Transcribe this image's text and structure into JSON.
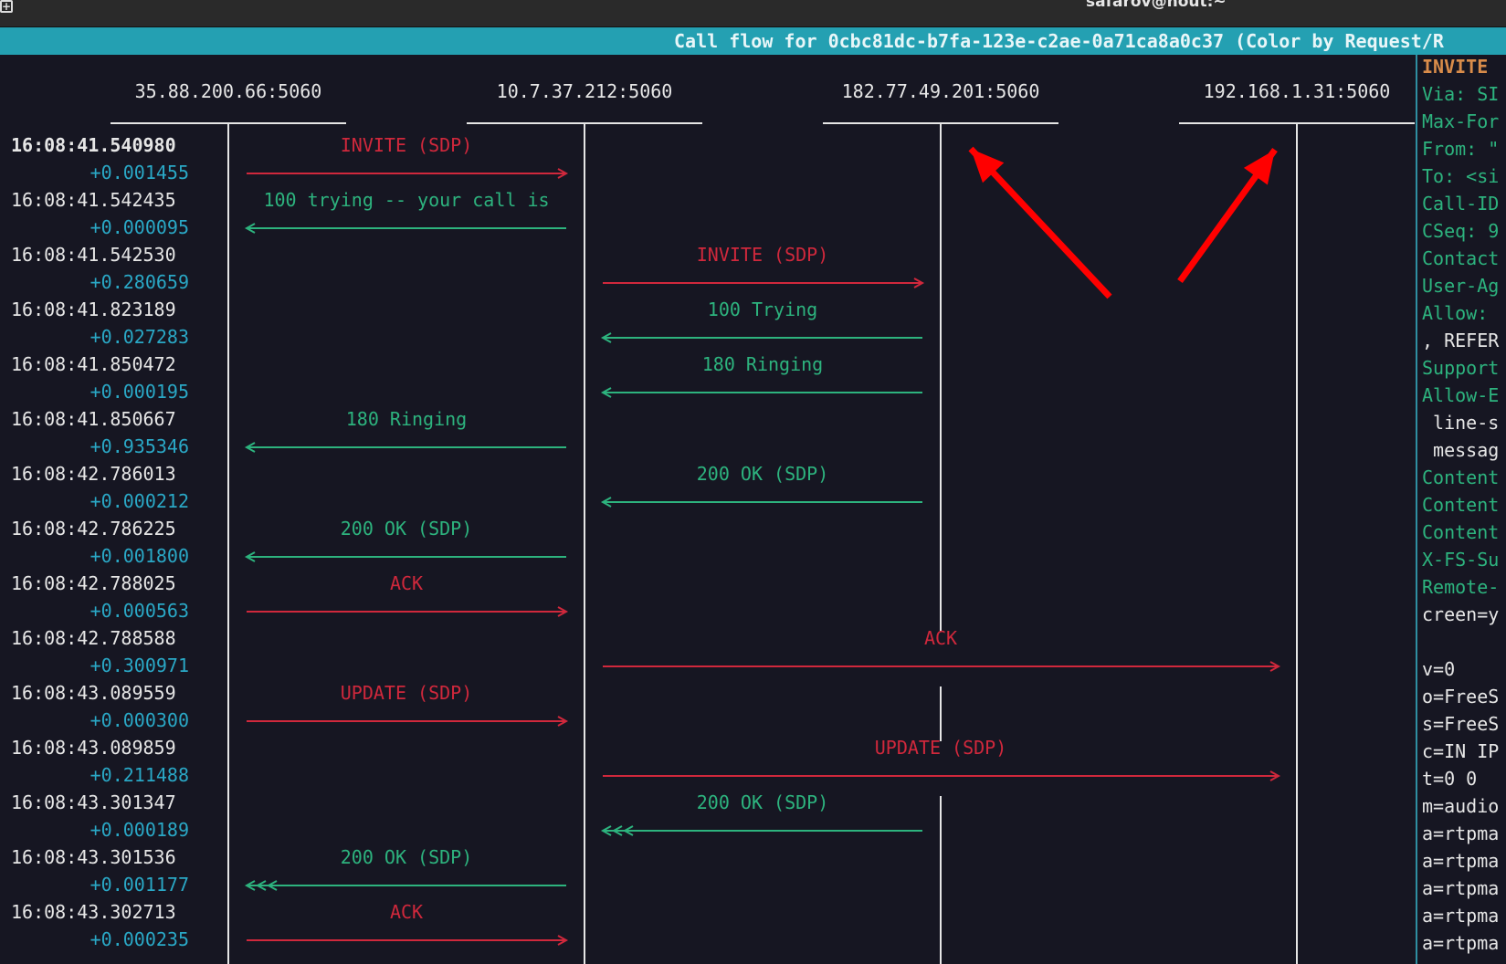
{
  "window": {
    "title": "safarov@nout:~",
    "newtab_glyph": "+"
  },
  "header": {
    "text": "Call flow for 0cbc81dc-b7fa-123e-c2ae-0a71ca8a0c37 (Color by Request/R"
  },
  "colors": {
    "request": "#d0283c",
    "response": "#2db37e",
    "delta": "#2aa8c6",
    "time": "#e6e6e6",
    "lifeline": "#e6e6e6",
    "annotation_arrows": "#ff0000"
  },
  "hosts": [
    "35.88.200.66:5060",
    "10.7.37.212:5060",
    "182.77.49.201:5060",
    "192.168.1.31:5060"
  ],
  "rows": [
    {
      "time": "16:08:41.540980",
      "delta": "+0.001455",
      "label": "INVITE (SDP)",
      "kind": "request",
      "from": 0,
      "to": 1,
      "selected": true
    },
    {
      "time": "16:08:41.542435",
      "delta": "+0.000095",
      "label": "100 trying -- your call is",
      "kind": "response",
      "from": 1,
      "to": 0
    },
    {
      "time": "16:08:41.542530",
      "delta": "+0.280659",
      "label": "INVITE (SDP)",
      "kind": "request",
      "from": 1,
      "to": 2
    },
    {
      "time": "16:08:41.823189",
      "delta": "+0.027283",
      "label": "100 Trying",
      "kind": "response",
      "from": 2,
      "to": 1
    },
    {
      "time": "16:08:41.850472",
      "delta": "+0.000195",
      "label": "180 Ringing",
      "kind": "response",
      "from": 2,
      "to": 1
    },
    {
      "time": "16:08:41.850667",
      "delta": "+0.935346",
      "label": "180 Ringing",
      "kind": "response",
      "from": 1,
      "to": 0
    },
    {
      "time": "16:08:42.786013",
      "delta": "+0.000212",
      "label": "200 OK (SDP)",
      "kind": "response",
      "from": 2,
      "to": 1
    },
    {
      "time": "16:08:42.786225",
      "delta": "+0.001800",
      "label": "200 OK (SDP)",
      "kind": "response",
      "from": 1,
      "to": 0
    },
    {
      "time": "16:08:42.788025",
      "delta": "+0.000563",
      "label": "ACK",
      "kind": "request",
      "from": 0,
      "to": 1
    },
    {
      "time": "16:08:42.788588",
      "delta": "+0.300971",
      "label": "ACK",
      "kind": "request",
      "from": 1,
      "to": 3
    },
    {
      "time": "16:08:43.089559",
      "delta": "+0.000300",
      "label": "UPDATE (SDP)",
      "kind": "request",
      "from": 0,
      "to": 1
    },
    {
      "time": "16:08:43.089859",
      "delta": "+0.211488",
      "label": "UPDATE (SDP)",
      "kind": "request",
      "from": 1,
      "to": 3
    },
    {
      "time": "16:08:43.301347",
      "delta": "+0.000189",
      "label": "200 OK (SDP)",
      "kind": "response",
      "from": 2,
      "to": 1,
      "retrans": true
    },
    {
      "time": "16:08:43.301536",
      "delta": "+0.001177",
      "label": "200 OK (SDP)",
      "kind": "response",
      "from": 1,
      "to": 0,
      "retrans": true
    },
    {
      "time": "16:08:43.302713",
      "delta": "+0.000235",
      "label": "ACK",
      "kind": "request",
      "from": 0,
      "to": 1
    }
  ],
  "details": [
    {
      "text": "INVITE",
      "style": "method"
    },
    {
      "text": "Via: SI",
      "style": "key"
    },
    {
      "text": "Max-For",
      "style": "key"
    },
    {
      "text": "From: \"",
      "style": "key"
    },
    {
      "text": "To: <si",
      "style": "key"
    },
    {
      "text": "Call-ID",
      "style": "key"
    },
    {
      "text": "CSeq: 9",
      "style": "key"
    },
    {
      "text": "Contact",
      "style": "key"
    },
    {
      "text": "User-Ag",
      "style": "key"
    },
    {
      "text": "Allow: ",
      "style": "key"
    },
    {
      "text": ", REFER",
      "style": "plain"
    },
    {
      "text": "Support",
      "style": "key"
    },
    {
      "text": "Allow-E",
      "style": "key"
    },
    {
      "text": " line-s",
      "style": "plain"
    },
    {
      "text": " messag",
      "style": "plain"
    },
    {
      "text": "Content",
      "style": "key"
    },
    {
      "text": "Content",
      "style": "key"
    },
    {
      "text": "Content",
      "style": "key"
    },
    {
      "text": "X-FS-Su",
      "style": "key"
    },
    {
      "text": "Remote-",
      "style": "key"
    },
    {
      "text": "creen=y",
      "style": "plain"
    },
    {
      "text": "",
      "style": "plain"
    },
    {
      "text": "v=0",
      "style": "plain"
    },
    {
      "text": "o=FreeS",
      "style": "plain"
    },
    {
      "text": "s=FreeS",
      "style": "plain"
    },
    {
      "text": "c=IN IP",
      "style": "plain"
    },
    {
      "text": "t=0 0",
      "style": "plain"
    },
    {
      "text": "m=audio",
      "style": "plain"
    },
    {
      "text": "a=rtpma",
      "style": "plain"
    },
    {
      "text": "a=rtpma",
      "style": "plain"
    },
    {
      "text": "a=rtpma",
      "style": "plain"
    },
    {
      "text": "a=rtpma",
      "style": "plain"
    },
    {
      "text": "a=rtpma",
      "style": "plain"
    }
  ]
}
